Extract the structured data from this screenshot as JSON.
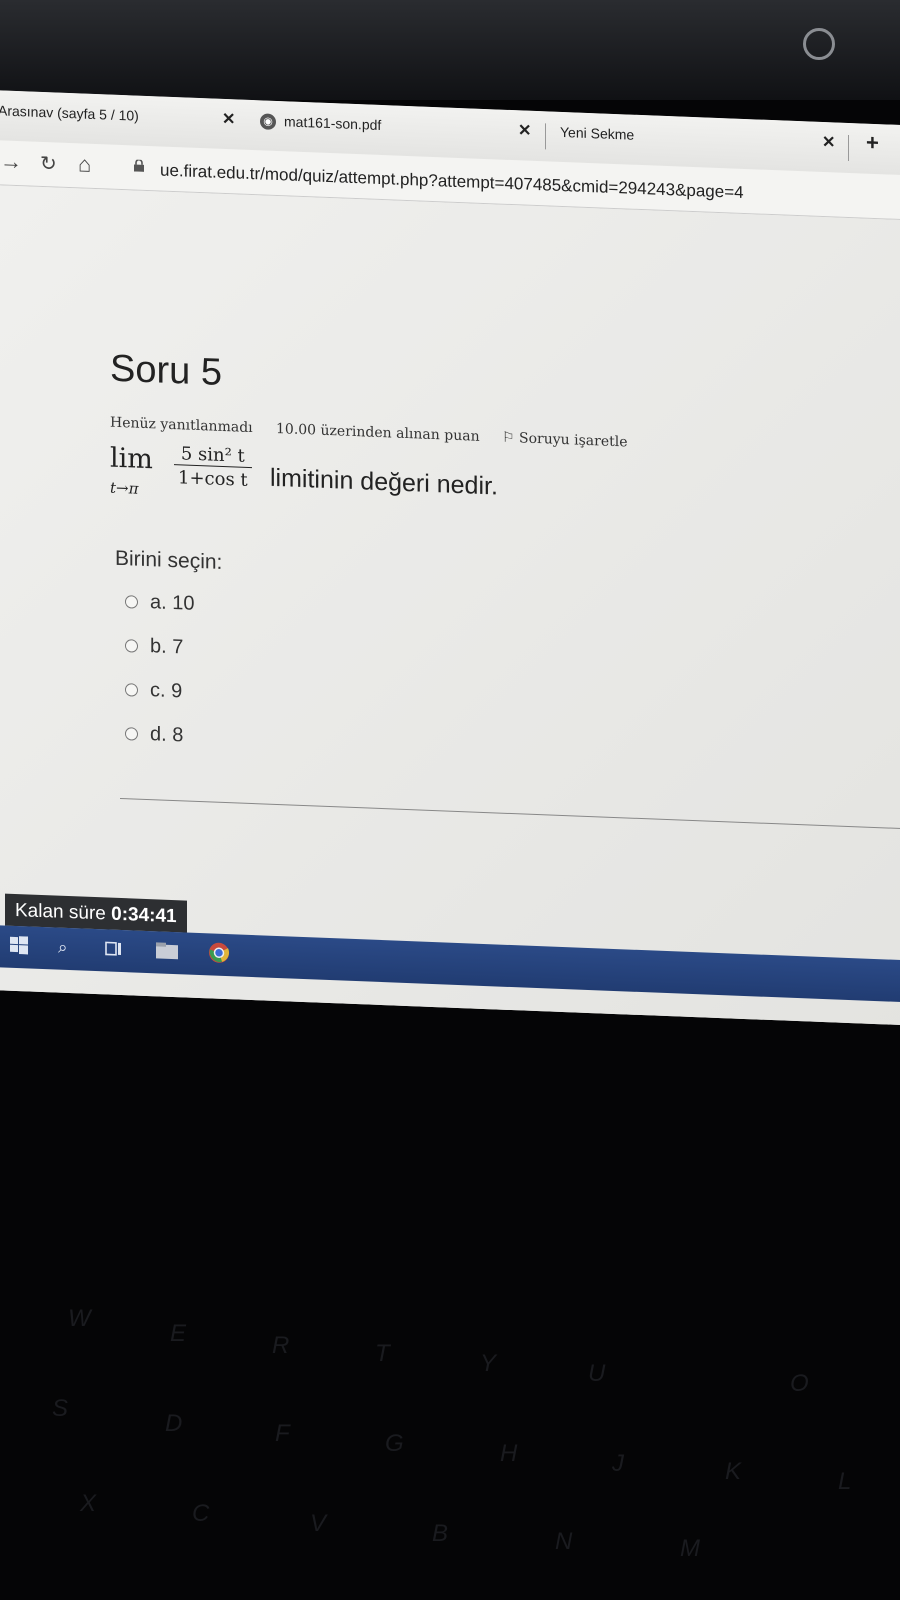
{
  "browser": {
    "tabs": [
      {
        "label": "Arasınav (sayfa 5 / 10)"
      },
      {
        "label": "mat161-son.pdf"
      },
      {
        "label": "Yeni Sekme"
      }
    ],
    "url": "ue.firat.edu.tr/mod/quiz/attempt.php?attempt=407485&cmid=294243&page=4"
  },
  "question": {
    "title": "Soru 5",
    "status": "Henüz yanıtlanmadı",
    "points": "10.00 üzerinden alınan puan",
    "flag_label": "Soruyu işaretle",
    "formula": {
      "lim": "lim",
      "sub": "t→π",
      "numerator": "5 sin² t",
      "denominator": "1+cos t"
    },
    "text": "limitinin değeri nedir.",
    "choose_label": "Birini seçin:",
    "options": [
      {
        "label": "a. 10"
      },
      {
        "label": "b. 7"
      },
      {
        "label": "c. 9"
      },
      {
        "label": "d. 8"
      }
    ]
  },
  "timer": {
    "label": "Kalan süre",
    "value": "0:34:41"
  },
  "keyboard": {
    "keys": [
      "W",
      "E",
      "R",
      "T",
      "Y",
      "U",
      "O",
      "S",
      "D",
      "F",
      "G",
      "H",
      "J",
      "K",
      "L",
      "X",
      "C",
      "V",
      "B",
      "N",
      "M"
    ]
  }
}
